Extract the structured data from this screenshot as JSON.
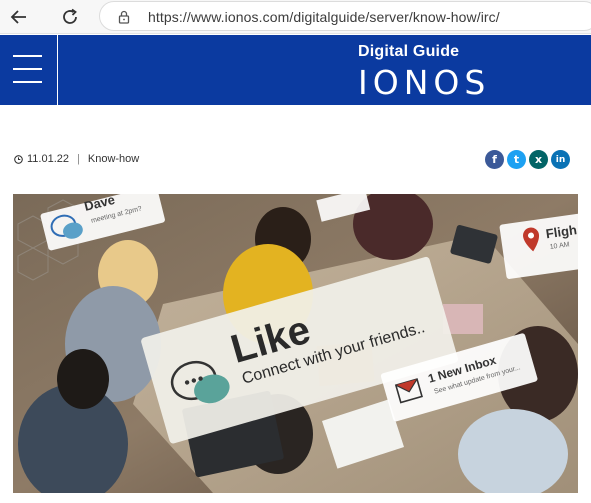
{
  "browser": {
    "url": "https://www.ionos.com/digitalguide/server/know-how/irc/"
  },
  "header": {
    "brand_top": "Digital Guide",
    "brand_logo": "IONOS"
  },
  "article": {
    "date": "11.01.22",
    "category": "Know-how"
  },
  "share": [
    {
      "name": "facebook",
      "glyph": "f"
    },
    {
      "name": "twitter",
      "glyph": "t"
    },
    {
      "name": "xing",
      "glyph": "x"
    },
    {
      "name": "linkedin",
      "glyph": "in"
    }
  ],
  "hero": {
    "card_main_title": "Like",
    "card_main_sub": "Connect with your friends..",
    "card_left_name": "Dave",
    "card_left_sub": "meeting at 2pm?",
    "card_right_title": "Fligh",
    "card_right_sub": "10 AM",
    "card_inbox_title": "1 New Inbox",
    "card_inbox_sub": "See what update from your..."
  },
  "colors": {
    "brand_blue": "#0b3aa0",
    "facebook": "#3b5998",
    "twitter": "#1da1f2",
    "xing": "#026466",
    "linkedin": "#0a72b5"
  }
}
